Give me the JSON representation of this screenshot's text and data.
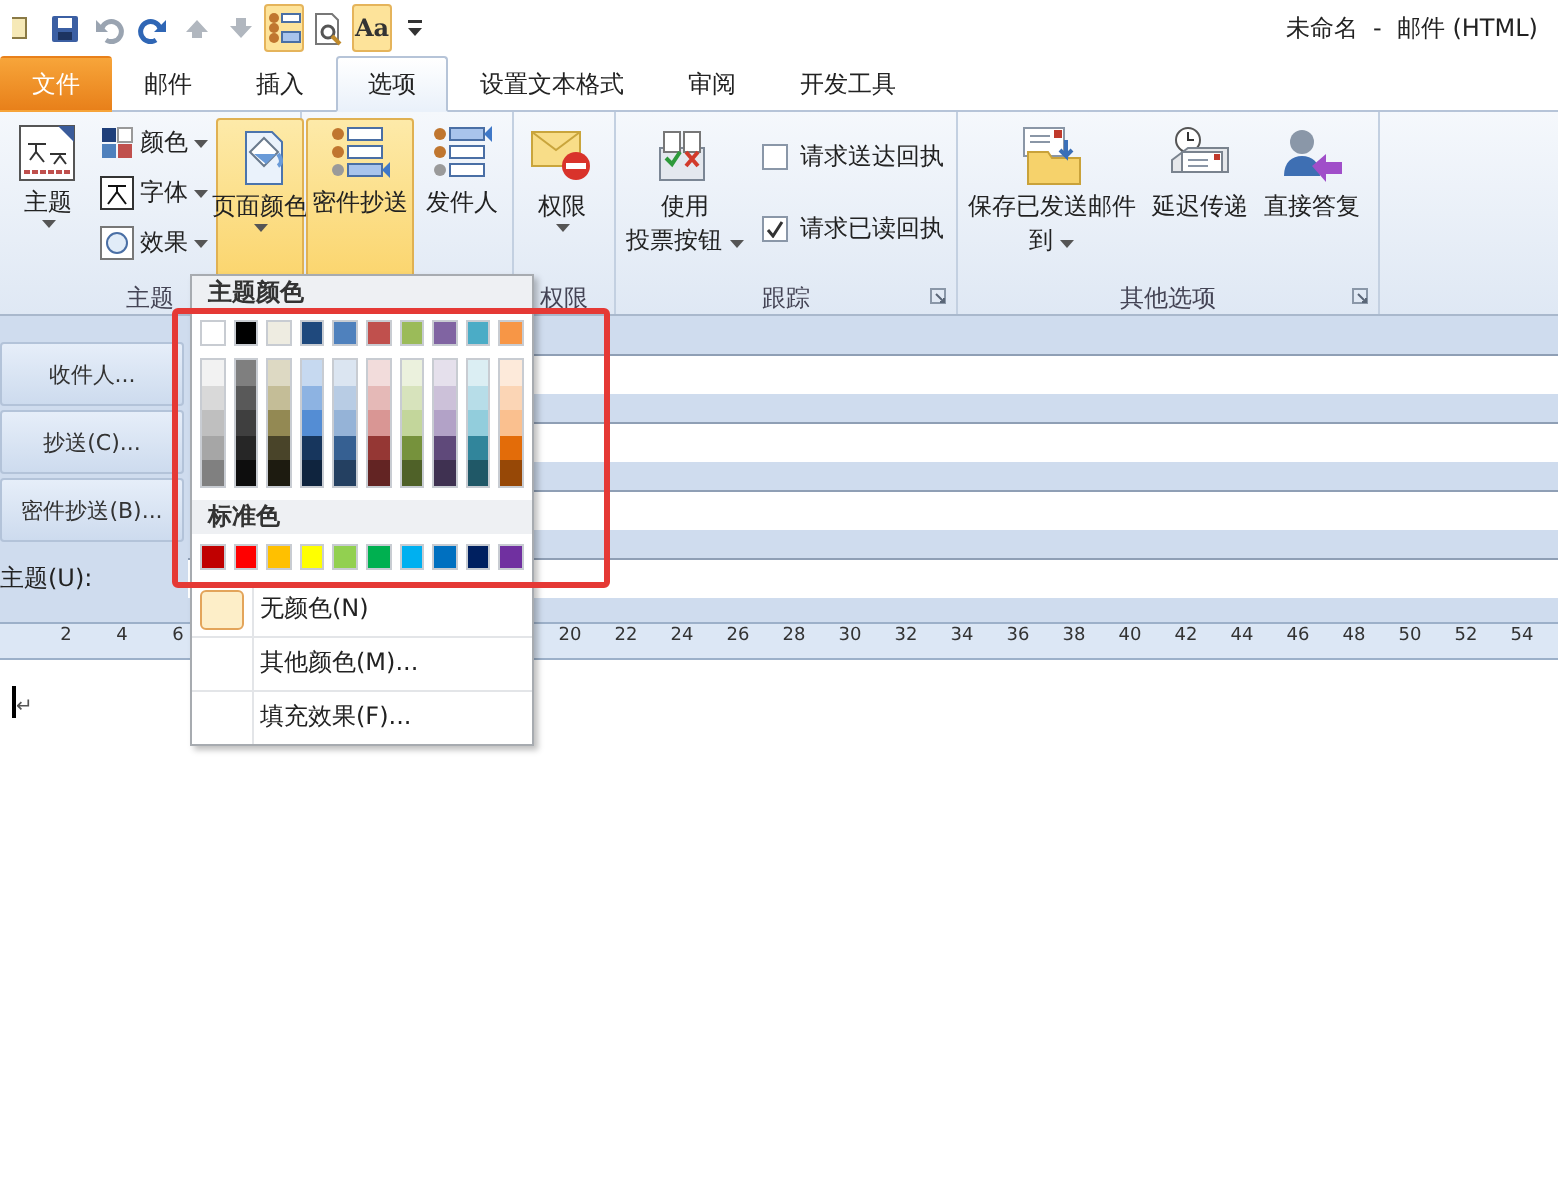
{
  "window": {
    "title": "未命名  -  邮件 (HTML)"
  },
  "quick_access": [
    {
      "kind": "app",
      "on": false
    },
    {
      "kind": "save",
      "on": false
    },
    {
      "kind": "undo",
      "on": false
    },
    {
      "kind": "redo",
      "on": false
    },
    {
      "kind": "up",
      "on": false
    },
    {
      "kind": "down",
      "on": false
    },
    {
      "kind": "fields",
      "on": true
    },
    {
      "kind": "preview",
      "on": false
    },
    {
      "kind": "text",
      "label": "Aa",
      "on": true
    },
    {
      "kind": "more",
      "on": false
    }
  ],
  "tabs": [
    {
      "label": "文件",
      "kind": "file",
      "selected": false
    },
    {
      "label": "邮件",
      "selected": false
    },
    {
      "label": "插入",
      "selected": false
    },
    {
      "label": "选项",
      "selected": true
    },
    {
      "label": "设置文本格式",
      "selected": false
    },
    {
      "label": "审阅",
      "selected": false
    },
    {
      "label": "开发工具",
      "selected": false
    }
  ],
  "ribbon_groups": [
    {
      "label": "主题",
      "launcher": false,
      "items": [
        {
          "kind": "large",
          "lines": [
            "主题"
          ],
          "dropdown": true,
          "on": false
        },
        {
          "kind": "stack",
          "items": [
            {
              "label": "颜色"
            },
            {
              "label": "字体"
            },
            {
              "label": "效果"
            }
          ]
        },
        {
          "kind": "large",
          "lines": [
            "页面颜色"
          ],
          "dropdown": true,
          "on": true
        }
      ]
    },
    {
      "items": [
        {
          "kind": "large",
          "lines": [
            "密件抄送"
          ],
          "dropdown": false,
          "on": true
        },
        {
          "kind": "large",
          "lines": [
            "发件人"
          ],
          "dropdown": false,
          "on": false
        }
      ]
    },
    {
      "label": "权限",
      "launcher": false,
      "items": [
        {
          "kind": "large",
          "lines": [
            "权限"
          ],
          "dropdown": true,
          "on": false
        }
      ]
    },
    {
      "label": "跟踪",
      "launcher": true,
      "items": [
        {
          "kind": "large",
          "lines": [
            "使用",
            "投票按钮"
          ],
          "dropdown": true,
          "on": false
        },
        {
          "kind": "checks",
          "items": [
            {
              "label": "请求送达回执",
              "checked": false
            },
            {
              "label": "请求已读回执",
              "checked": true
            }
          ]
        }
      ]
    },
    {
      "label": "其他选项",
      "launcher": true,
      "items": [
        {
          "kind": "large",
          "lines": [
            "保存已发送邮件",
            "到"
          ],
          "dropdown": true,
          "on": false
        },
        {
          "kind": "large",
          "lines": [
            "延迟传递"
          ],
          "dropdown": false,
          "on": false
        },
        {
          "kind": "large",
          "lines": [
            "直接答复"
          ],
          "dropdown": false,
          "on": false
        }
      ]
    }
  ],
  "address_rows": [
    {
      "label": "收件人...",
      "kind": "button"
    },
    {
      "label": "抄送(C)...",
      "kind": "button"
    },
    {
      "label": "密件抄送(B)...",
      "kind": "button"
    },
    {
      "label": "主题(U):",
      "kind": "label"
    }
  ],
  "ruler": {
    "left_labels": [
      "2",
      "4",
      "6"
    ],
    "right_labels": [
      "20",
      "22",
      "24",
      "26",
      "28",
      "30",
      "32",
      "34",
      "36",
      "38",
      "40",
      "42",
      "44",
      "46",
      "48",
      "50",
      "52",
      "54"
    ]
  },
  "body": {
    "mark": "↵"
  },
  "color_menu": {
    "theme_heading": "主题颜色",
    "theme_colors": [
      {
        "color": "#ffffff",
        "shades": [
          {
            "color": "#f2f2f2"
          },
          {
            "color": "#d9d9d9"
          },
          {
            "color": "#bfbfbf"
          },
          {
            "color": "#a6a6a6"
          },
          {
            "color": "#808080"
          }
        ]
      },
      {
        "color": "#000000",
        "shades": [
          {
            "color": "#7f7f7f"
          },
          {
            "color": "#595959"
          },
          {
            "color": "#3f3f3f"
          },
          {
            "color": "#262626"
          },
          {
            "color": "#0d0d0d"
          }
        ]
      },
      {
        "color": "#eeece1",
        "shades": [
          {
            "color": "#ddd9c3"
          },
          {
            "color": "#c4bd97"
          },
          {
            "color": "#938953"
          },
          {
            "color": "#494429"
          },
          {
            "color": "#1d1b10"
          }
        ]
      },
      {
        "color": "#1f497d",
        "shades": [
          {
            "color": "#c6d9f0"
          },
          {
            "color": "#8db3e2"
          },
          {
            "color": "#548dd4"
          },
          {
            "color": "#17365d"
          },
          {
            "color": "#0f243e"
          }
        ]
      },
      {
        "color": "#4f81bd",
        "shades": [
          {
            "color": "#dbe5f1"
          },
          {
            "color": "#b8cce4"
          },
          {
            "color": "#95b3d7"
          },
          {
            "color": "#366092"
          },
          {
            "color": "#244061"
          }
        ]
      },
      {
        "color": "#c0504d",
        "shades": [
          {
            "color": "#f2dcdb"
          },
          {
            "color": "#e5b9b7"
          },
          {
            "color": "#d99694"
          },
          {
            "color": "#953734"
          },
          {
            "color": "#632423"
          }
        ]
      },
      {
        "color": "#9bbb59",
        "shades": [
          {
            "color": "#ebf1dd"
          },
          {
            "color": "#d7e3bc"
          },
          {
            "color": "#c3d69b"
          },
          {
            "color": "#76923c"
          },
          {
            "color": "#4f6128"
          }
        ]
      },
      {
        "color": "#8064a2",
        "shades": [
          {
            "color": "#e5e0ec"
          },
          {
            "color": "#ccc1d9"
          },
          {
            "color": "#b2a2c7"
          },
          {
            "color": "#5f497a"
          },
          {
            "color": "#3f3151"
          }
        ]
      },
      {
        "color": "#4bacc6",
        "shades": [
          {
            "color": "#dbeef3"
          },
          {
            "color": "#b7dde8"
          },
          {
            "color": "#92cddc"
          },
          {
            "color": "#31859b"
          },
          {
            "color": "#205867"
          }
        ]
      },
      {
        "color": "#f79646",
        "shades": [
          {
            "color": "#fdeada"
          },
          {
            "color": "#fbd5b5"
          },
          {
            "color": "#fac08f"
          },
          {
            "color": "#e36c09"
          },
          {
            "color": "#974806"
          }
        ]
      }
    ],
    "standard_heading": "标准色",
    "standard_colors": [
      {
        "color": "#c00000"
      },
      {
        "color": "#ff0000"
      },
      {
        "color": "#ffc000"
      },
      {
        "color": "#ffff00"
      },
      {
        "color": "#92d050"
      },
      {
        "color": "#00b050"
      },
      {
        "color": "#00b0f0"
      },
      {
        "color": "#0070c0"
      },
      {
        "color": "#002060"
      },
      {
        "color": "#7030a0"
      }
    ],
    "items": [
      {
        "label": "无颜色(N)",
        "kind": "swatch",
        "color": "#fdeec8"
      },
      {
        "label": "其他颜色(M)...",
        "kind": "plain"
      },
      {
        "label": "填充效果(F)...",
        "kind": "plain"
      }
    ]
  }
}
